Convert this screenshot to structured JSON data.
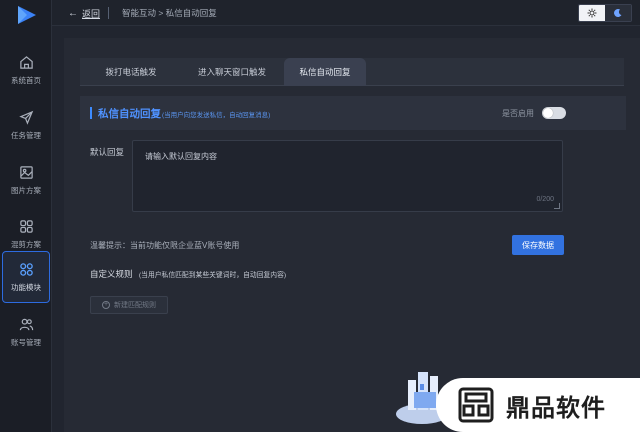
{
  "header": {
    "back_label": "返回",
    "breadcrumb": "智能互动 > 私信自动回复"
  },
  "sidebar": {
    "items": [
      {
        "label": "系统首页",
        "icon": "home-icon"
      },
      {
        "label": "任务管理",
        "icon": "send-icon"
      },
      {
        "label": "图片方案",
        "icon": "image-icon"
      },
      {
        "label": "混剪方案",
        "icon": "grid-icon"
      },
      {
        "label": "功能模块",
        "icon": "modules-icon",
        "active": true
      },
      {
        "label": "账号管理",
        "icon": "users-icon"
      }
    ]
  },
  "tabs": [
    {
      "label": "拨打电话触发"
    },
    {
      "label": "进入聊天窗口触发"
    },
    {
      "label": "私信自动回复",
      "active": true
    }
  ],
  "section": {
    "title": "私信自动回复",
    "hint": "(当用户向您发送私信，自动回复消息)",
    "enable_label": "是否启用",
    "enabled": false
  },
  "default_reply": {
    "label": "默认回复",
    "placeholder": "请输入默认回复内容",
    "count": "0/200"
  },
  "tip": "温馨提示：当前功能仅限企业蓝V账号使用",
  "save_label": "保存数据",
  "custom_rules": {
    "title": "自定义规则",
    "hint": "(当用户私信匹配到某些关键词时，自动回复内容)",
    "add_label": "新建匹配规则"
  },
  "watermark": {
    "text": "鼎品软件"
  },
  "colors": {
    "accent": "#3272e0",
    "highlight": "#4f92ff",
    "background": "#21252f"
  }
}
